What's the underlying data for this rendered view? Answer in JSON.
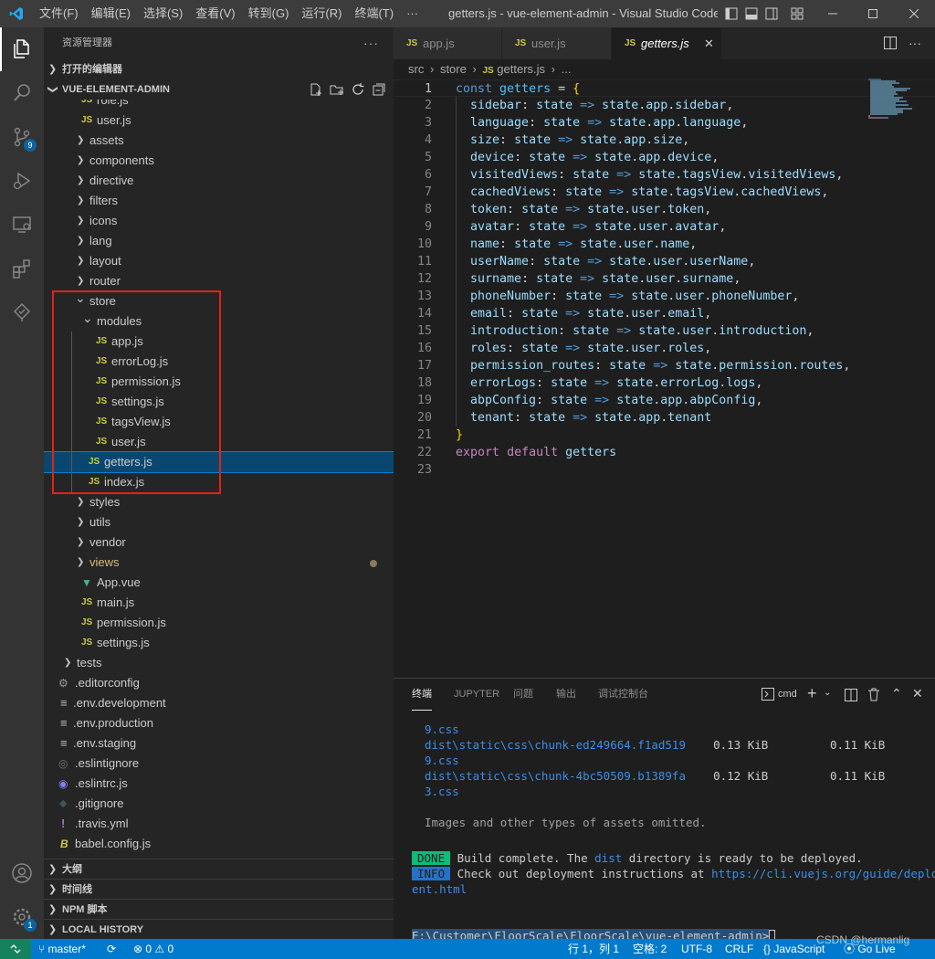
{
  "titlebar": {
    "menu": [
      "文件(F)",
      "编辑(E)",
      "选择(S)",
      "查看(V)",
      "转到(G)",
      "运行(R)",
      "终端(T)",
      "···"
    ],
    "window_title": "getters.js - vue-element-admin - Visual Studio Code [..."
  },
  "activity": {
    "source_control_badge": "9",
    "settings_badge": "1"
  },
  "sidebar": {
    "title": "资源管理器",
    "open_editors": "打开的编辑器",
    "project": "VUE-ELEMENT-ADMIN",
    "tree": [
      {
        "label": "role.js",
        "type": "js",
        "indent": 1
      },
      {
        "label": "user.js",
        "type": "js",
        "indent": 1
      },
      {
        "label": "assets",
        "type": "folder",
        "indent": 1
      },
      {
        "label": "components",
        "type": "folder",
        "indent": 1
      },
      {
        "label": "directive",
        "type": "folder",
        "indent": 1
      },
      {
        "label": "filters",
        "type": "folder",
        "indent": 1
      },
      {
        "label": "icons",
        "type": "folder",
        "indent": 1
      },
      {
        "label": "lang",
        "type": "folder",
        "indent": 1
      },
      {
        "label": "layout",
        "type": "folder",
        "indent": 1
      },
      {
        "label": "router",
        "type": "folder",
        "indent": 1
      },
      {
        "label": "store",
        "type": "folder-open",
        "indent": 1
      },
      {
        "label": "modules",
        "type": "folder-open",
        "indent": 2
      },
      {
        "label": "app.js",
        "type": "js",
        "indent": 3
      },
      {
        "label": "errorLog.js",
        "type": "js",
        "indent": 3
      },
      {
        "label": "permission.js",
        "type": "js",
        "indent": 3
      },
      {
        "label": "settings.js",
        "type": "js",
        "indent": 3
      },
      {
        "label": "tagsView.js",
        "type": "js",
        "indent": 3
      },
      {
        "label": "user.js",
        "type": "js",
        "indent": 3
      },
      {
        "label": "getters.js",
        "type": "js",
        "indent": 2,
        "selected": true
      },
      {
        "label": "index.js",
        "type": "js",
        "indent": 2
      },
      {
        "label": "styles",
        "type": "folder",
        "indent": 1
      },
      {
        "label": "utils",
        "type": "folder",
        "indent": 1
      },
      {
        "label": "vendor",
        "type": "folder",
        "indent": 1
      },
      {
        "label": "views",
        "type": "folder",
        "indent": 1,
        "modified": true
      },
      {
        "label": "App.vue",
        "type": "vue",
        "indent": 1
      },
      {
        "label": "main.js",
        "type": "js",
        "indent": 1
      },
      {
        "label": "permission.js",
        "type": "js",
        "indent": 1
      },
      {
        "label": "settings.js",
        "type": "js",
        "indent": 1
      },
      {
        "label": "tests",
        "type": "folder",
        "indent": 0
      },
      {
        "label": ".editorconfig",
        "type": "gear",
        "indent": 0
      },
      {
        "label": ".env.development",
        "type": "lines",
        "indent": 0
      },
      {
        "label": ".env.production",
        "type": "lines",
        "indent": 0
      },
      {
        "label": ".env.staging",
        "type": "lines",
        "indent": 0
      },
      {
        "label": ".eslintignore",
        "type": "circle",
        "indent": 0
      },
      {
        "label": ".eslintrc.js",
        "type": "eslint",
        "indent": 0
      },
      {
        "label": ".gitignore",
        "type": "git",
        "indent": 0
      },
      {
        "label": ".travis.yml",
        "type": "yml",
        "indent": 0
      },
      {
        "label": "babel.config.js",
        "type": "babel",
        "indent": 0
      }
    ],
    "sections": [
      "大纲",
      "时间线",
      "NPM 脚本",
      "LOCAL HISTORY"
    ]
  },
  "tabs": [
    {
      "label": "app.js",
      "active": false
    },
    {
      "label": "user.js",
      "active": false
    },
    {
      "label": "getters.js",
      "active": true
    }
  ],
  "breadcrumb": [
    "src",
    "store",
    "getters.js",
    "..."
  ],
  "code": [
    "const getters = {",
    "  sidebar: state => state.app.sidebar,",
    "  language: state => state.app.language,",
    "  size: state => state.app.size,",
    "  device: state => state.app.device,",
    "  visitedViews: state => state.tagsView.visitedViews,",
    "  cachedViews: state => state.tagsView.cachedViews,",
    "  token: state => state.user.token,",
    "  avatar: state => state.user.avatar,",
    "  name: state => state.user.name,",
    "  userName: state => state.user.userName,",
    "  surname: state => state.user.surname,",
    "  phoneNumber: state => state.user.phoneNumber,",
    "  email: state => state.user.email,",
    "  introduction: state => state.user.introduction,",
    "  roles: state => state.user.roles,",
    "  permission_routes: state => state.permission.routes,",
    "  errorLogs: state => state.errorLog.logs,",
    "  abpConfig: state => state.app.abpConfig,",
    "  tenant: state => state.app.tenant",
    "}",
    "export default getters",
    ""
  ],
  "panel": {
    "tabs": [
      "终端",
      "JUPYTER",
      "问题",
      "输出",
      "调试控制台"
    ],
    "shell": "cmd",
    "terminal": {
      "lines": [
        {
          "text": "9.css",
          "color": "cyan"
        },
        {
          "text": "dist\\static\\css\\chunk-ed249664.f1ad519    0.13 KiB         0.11 KiB",
          "color": "mixed"
        },
        {
          "text": "9.css",
          "color": "cyan"
        },
        {
          "text": "dist\\static\\css\\chunk-4bc50509.b1389fa    0.12 KiB         0.11 KiB",
          "color": "mixed"
        },
        {
          "text": "3.css",
          "color": "cyan"
        },
        {
          "text": "",
          "color": "plain"
        },
        {
          "text": "Images and other types of assets omitted.",
          "color": "dim"
        }
      ],
      "done_badge": "DONE",
      "done_text": "Build complete. The dist directory is ready to be deployed.",
      "info_badge": "INFO",
      "info_text": "Check out deployment instructions at https://cli.vuejs.org/guide/deploym",
      "info_text2": "ent.html",
      "prompt": "E:\\Customer\\FloorScale\\FloorScale\\vue-element-admin>"
    }
  },
  "status": {
    "branch": "master*",
    "problems": "⊗ 0 ⚠ 0",
    "position": "行 1，列 1",
    "spaces": "空格: 2",
    "encoding": "UTF-8",
    "eol": "CRLF",
    "language": "JavaScript",
    "golive": "Go Live",
    "watermark": "CSDN @hermanlig"
  }
}
